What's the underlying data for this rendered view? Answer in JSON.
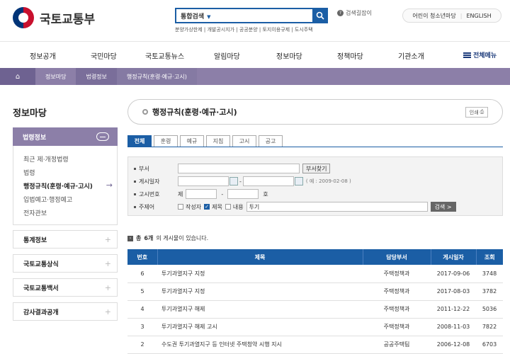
{
  "header": {
    "logo_text": "국토교통부",
    "search_select": "통합검색",
    "keywords": "분양가상한제 | 개발공시지가 | 공공분양 | 토지이용규제 | 도시주택",
    "keyguard": "검색길잡이",
    "kids_link": "어린이 청소년마당",
    "english_link": "ENGLISH"
  },
  "gnb": {
    "items": [
      "정보공개",
      "국민마당",
      "국토교통뉴스",
      "알림마당",
      "정보마당",
      "정책마당",
      "기관소개"
    ],
    "all_menu": "전체메뉴"
  },
  "breadcrumb": [
    "정보마당",
    "법령정보",
    "행정규칙(훈령·예규·고시)"
  ],
  "sidebar": {
    "title": "정보마당",
    "active_section": "법령정보",
    "sub_items": [
      "최근 제·개정법령",
      "법령",
      "행정규칙(훈령·예규·고시)",
      "입법예고·행정예고",
      "전자관보"
    ],
    "sections": [
      "통계정보",
      "국토교통상식",
      "국토교통백서",
      "감사결과공개"
    ]
  },
  "content": {
    "title": "행정규칙(훈령·예규·고시)",
    "print_label": "인쇄",
    "tabs": [
      "전체",
      "훈령",
      "예규",
      "지침",
      "고시",
      "공고"
    ],
    "form": {
      "dept_label": "부서",
      "dept_button": "부서찾기",
      "date_label": "게시일자",
      "date_hint": "( 예 : 2009-02-08 )",
      "num_label": "고시번호",
      "num_prefix": "제",
      "num_suffix": "호",
      "subject_label": "주제어",
      "chk_author": "작성자",
      "chk_title": "제목",
      "chk_content": "내용",
      "keyword_value": "투기",
      "search_button": "검색 >"
    },
    "total_prefix": "총",
    "total_count": "6개",
    "total_suffix": "의 게시물이 있습니다.",
    "table": {
      "headers": [
        "번호",
        "제목",
        "담당부서",
        "게시일자",
        "조회"
      ],
      "rows": [
        [
          "6",
          "투기과열지구 지정",
          "주택정책과",
          "2017-09-06",
          "3748"
        ],
        [
          "5",
          "투기과열지구 지정",
          "주택정책과",
          "2017-08-03",
          "3782"
        ],
        [
          "4",
          "투기과열지구 해제",
          "주택정책과",
          "2011-12-22",
          "5036"
        ],
        [
          "3",
          "투기과열지구 해제 고시",
          "주택정책과",
          "2008-11-03",
          "7822"
        ],
        [
          "2",
          "수도권 투기과열지구 등 인터넷 주택청약 시행 지시",
          "공공주택팀",
          "2006-12-08",
          "6703"
        ]
      ]
    }
  },
  "colors": {
    "primary": "#1b5ea5",
    "breadcrumb": "#8c7fa8",
    "sidebar_active": "#8c7fa8"
  }
}
